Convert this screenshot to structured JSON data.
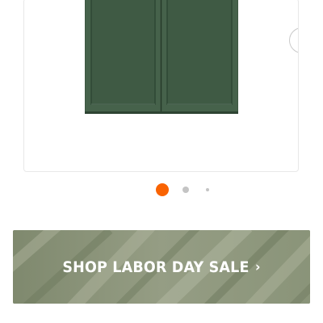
{
  "carousel": {
    "product_image": "green-two-door-wall-cabinet",
    "next_icon": "chevron-right-icon",
    "slide_count": 3,
    "active_slide": 1
  },
  "banner": {
    "label": "SHOP LABOR DAY SALE",
    "chevron": "›"
  },
  "colors": {
    "accent": "#f96302",
    "cabinet_green": "#3f5a44",
    "banner_olive": "#8e977c",
    "dot_inactive": "#c4c4c4"
  }
}
